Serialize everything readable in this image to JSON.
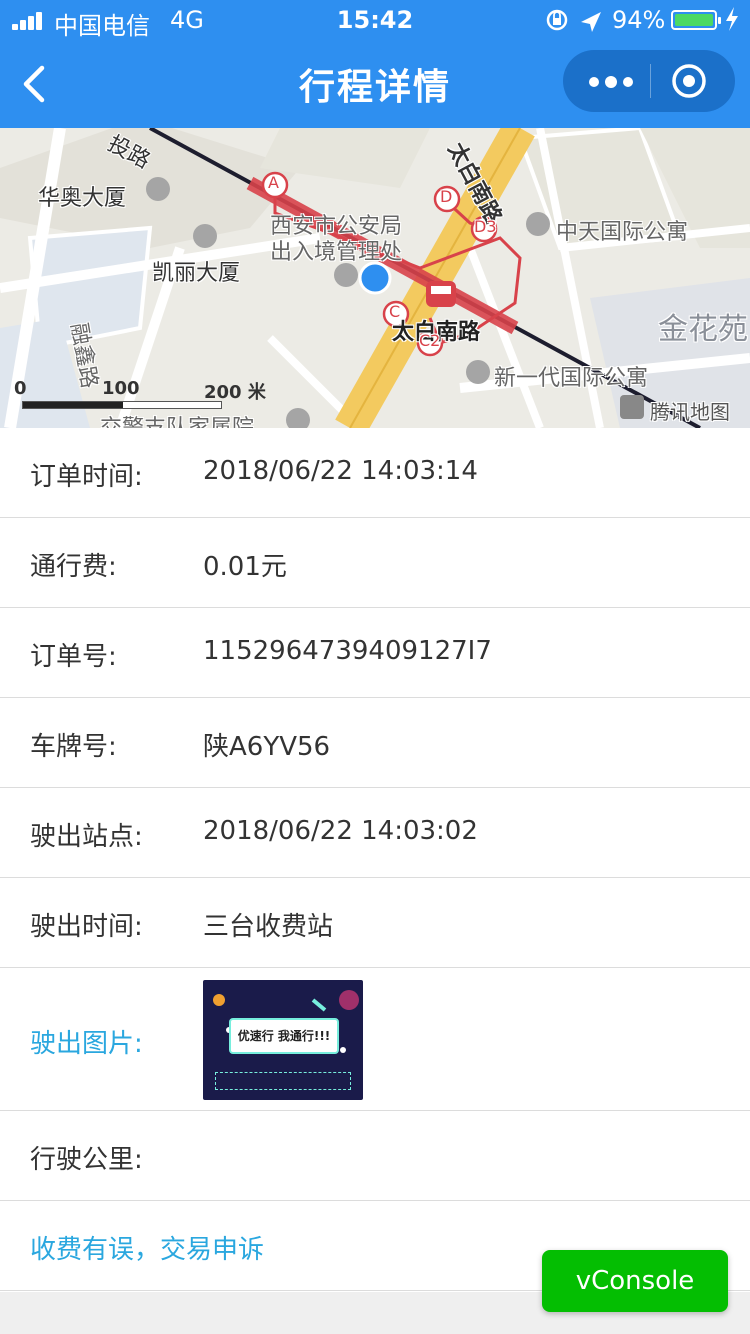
{
  "status_bar": {
    "carrier": "中国电信",
    "network": "4G",
    "time": "15:42",
    "battery_percent": "94%",
    "battery_level": 0.94
  },
  "nav": {
    "title": "行程详情",
    "more_icon": "more-dots-icon",
    "close_icon": "target-circle-icon"
  },
  "map": {
    "labels": {
      "huaao": "华奥大厦",
      "kaili": "凯丽大厦",
      "police_1": "西安市公安局",
      "police_2": "出入境管理处",
      "taibai": "太白南路",
      "zhongtian": "中天国际公寓",
      "xinyidai": "新一代国际公寓",
      "jinhua": "金花苑",
      "rongxin": "融鑫路",
      "road_nw": "投路",
      "road_vertical": "太白南路",
      "traffic": "交警支队家属院"
    },
    "exits": {
      "a": "A",
      "c": "C",
      "c2": "C2",
      "d": "D",
      "d3": "D3"
    },
    "scale": {
      "zero": "0",
      "mid": "100",
      "end": "200 米"
    },
    "provider": "腾讯地图"
  },
  "details": [
    {
      "label": "订单时间:",
      "value": "2018/06/22 14:03:14"
    },
    {
      "label": "通行费:",
      "value": "0.01元"
    },
    {
      "label": "订单号:",
      "value": "1152964739409127I7"
    },
    {
      "label": "车牌号:",
      "value": "陕A6YV56"
    },
    {
      "label": "驶出站点:",
      "value": "2018/06/22 14:03:02"
    },
    {
      "label": "驶出时间:",
      "value": "三台收费站"
    }
  ],
  "exit_image": {
    "label": "驶出图片:",
    "banner_text": "优速行 我通行!!!"
  },
  "mileage": {
    "label": "行驶公里:",
    "value": ""
  },
  "complaint_link": "收费有误，交易申诉",
  "vconsole": "vConsole",
  "colors": {
    "nav_blue": "#2e8ff0",
    "link_blue": "#2aa7df",
    "vconsole_green": "#04be02"
  }
}
